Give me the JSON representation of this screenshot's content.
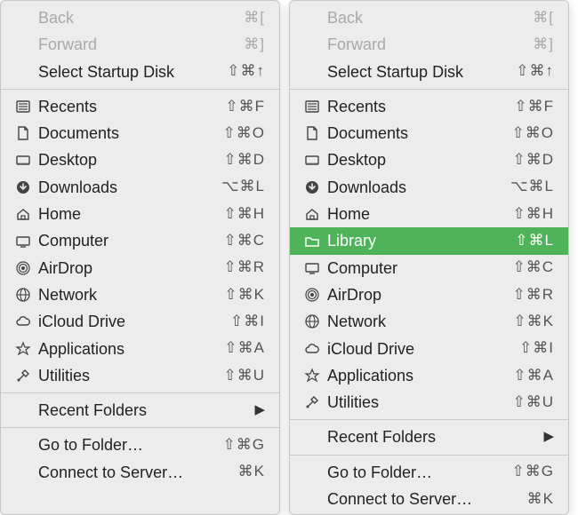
{
  "left": {
    "nav": {
      "back": {
        "label": "Back",
        "shortcut": "⌘["
      },
      "fwd": {
        "label": "Forward",
        "shortcut": "⌘]"
      },
      "startup": {
        "label": "Select Startup Disk",
        "shortcut": "⇧⌘↑"
      }
    },
    "locs": {
      "recents": {
        "label": "Recents",
        "shortcut": "⇧⌘F"
      },
      "docs": {
        "label": "Documents",
        "shortcut": "⇧⌘O"
      },
      "desktop": {
        "label": "Desktop",
        "shortcut": "⇧⌘D"
      },
      "downloads": {
        "label": "Downloads",
        "shortcut": "⌥⌘L"
      },
      "home": {
        "label": "Home",
        "shortcut": "⇧⌘H"
      },
      "computer": {
        "label": "Computer",
        "shortcut": "⇧⌘C"
      },
      "airdrop": {
        "label": "AirDrop",
        "shortcut": "⇧⌘R"
      },
      "network": {
        "label": "Network",
        "shortcut": "⇧⌘K"
      },
      "icloud": {
        "label": "iCloud Drive",
        "shortcut": "⇧⌘I"
      },
      "apps": {
        "label": "Applications",
        "shortcut": "⇧⌘A"
      },
      "utils": {
        "label": "Utilities",
        "shortcut": "⇧⌘U"
      }
    },
    "recent": {
      "label": "Recent Folders"
    },
    "goto": {
      "label": "Go to Folder…",
      "shortcut": "⇧⌘G"
    },
    "connect": {
      "label": "Connect to Server…",
      "shortcut": "⌘K"
    }
  },
  "right": {
    "nav": {
      "back": {
        "label": "Back",
        "shortcut": "⌘["
      },
      "fwd": {
        "label": "Forward",
        "shortcut": "⌘]"
      },
      "startup": {
        "label": "Select Startup Disk",
        "shortcut": "⇧⌘↑"
      }
    },
    "locs": {
      "recents": {
        "label": "Recents",
        "shortcut": "⇧⌘F"
      },
      "docs": {
        "label": "Documents",
        "shortcut": "⇧⌘O"
      },
      "desktop": {
        "label": "Desktop",
        "shortcut": "⇧⌘D"
      },
      "downloads": {
        "label": "Downloads",
        "shortcut": "⌥⌘L"
      },
      "home": {
        "label": "Home",
        "shortcut": "⇧⌘H"
      },
      "library": {
        "label": "Library",
        "shortcut": "⇧⌘L"
      },
      "computer": {
        "label": "Computer",
        "shortcut": "⇧⌘C"
      },
      "airdrop": {
        "label": "AirDrop",
        "shortcut": "⇧⌘R"
      },
      "network": {
        "label": "Network",
        "shortcut": "⇧⌘K"
      },
      "icloud": {
        "label": "iCloud Drive",
        "shortcut": "⇧⌘I"
      },
      "apps": {
        "label": "Applications",
        "shortcut": "⇧⌘A"
      },
      "utils": {
        "label": "Utilities",
        "shortcut": "⇧⌘U"
      }
    },
    "recent": {
      "label": "Recent Folders"
    },
    "goto": {
      "label": "Go to Folder…",
      "shortcut": "⇧⌘G"
    },
    "connect": {
      "label": "Connect to Server…",
      "shortcut": "⌘K"
    }
  }
}
